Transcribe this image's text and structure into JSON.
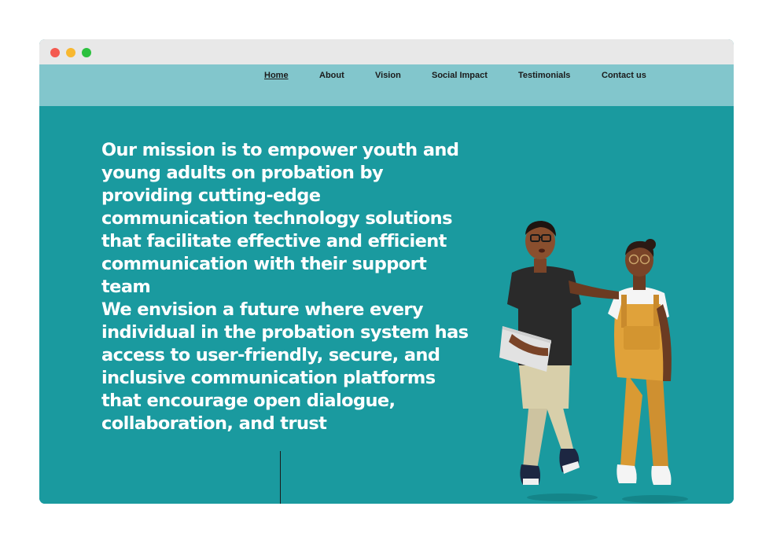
{
  "window": {
    "controls": [
      "close",
      "minimize",
      "zoom"
    ]
  },
  "nav": {
    "items": [
      {
        "label": "Home",
        "active": true
      },
      {
        "label": "About",
        "active": false
      },
      {
        "label": "Vision",
        "active": false
      },
      {
        "label": "Social Impact",
        "active": false
      },
      {
        "label": "Testimonials",
        "active": false
      },
      {
        "label": "Contact us",
        "active": false
      }
    ]
  },
  "hero": {
    "mission": "Our mission is to empower youth and young adults on probation by providing cutting-edge communication technology solutions that facilitate effective and efficient communication with their support team",
    "vision": "We envision a future where every individual in the probation system has access to user-friendly, secure, and inclusive communication platforms that encourage open dialogue, collaboration, and trust",
    "illustration": "two-people-illustration"
  },
  "colors": {
    "hero_bg": "#1a9a9f",
    "nav_bg": "#82c6cc",
    "text": "#ffffff",
    "nav_text": "#1b1b1b"
  }
}
